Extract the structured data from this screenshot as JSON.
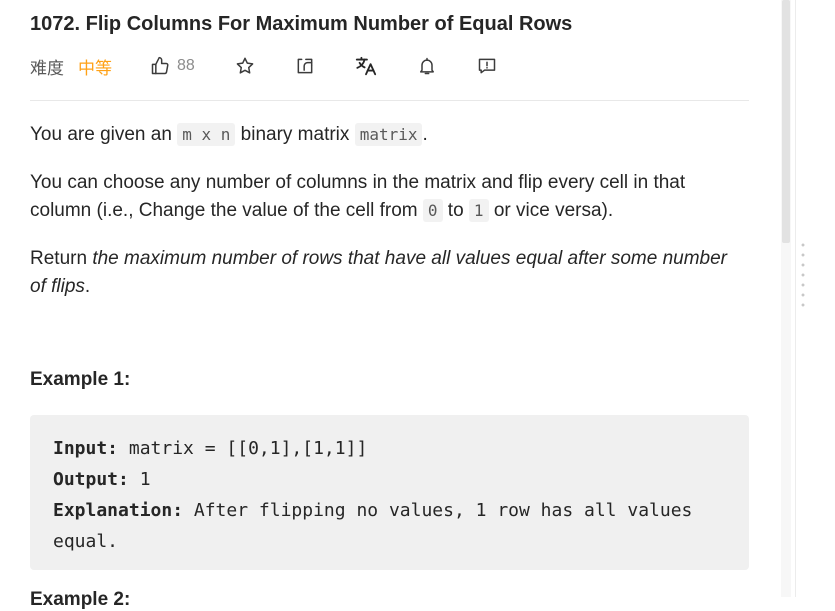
{
  "problem": {
    "title": "1072. Flip Columns For Maximum Number of Equal Rows",
    "difficulty_label": "难度",
    "difficulty_value": "中等",
    "likes": "88"
  },
  "description": {
    "p1_before": "You are given an ",
    "p1_code1": "m x n",
    "p1_middle": " binary matrix ",
    "p1_code2": "matrix",
    "p1_end": ".",
    "p2_before": "You can choose any number of columns in the matrix and flip every cell in that column (i.e., Change the value of the cell from ",
    "p2_code1": "0",
    "p2_middle": " to ",
    "p2_code2": "1",
    "p2_end": " or vice versa).",
    "p3_before": "Return ",
    "p3_italic": "the maximum number of rows that have all values equal after some number of flips",
    "p3_end": "."
  },
  "example1": {
    "title": "Example 1:",
    "input_label": "Input:",
    "input_value": " matrix = [[0,1],[1,1]]",
    "output_label": "Output:",
    "output_value": " 1",
    "explanation_label": "Explanation:",
    "explanation_value": " After flipping no values, 1 row has all values",
    "explanation_cont": "equal."
  },
  "example2": {
    "title": "Example 2:"
  },
  "icons": [
    "thumbs-up-icon",
    "star-icon",
    "share-icon",
    "translate-icon",
    "bell-icon",
    "feedback-icon"
  ],
  "colors": {
    "difficulty_medium": "#ffa116",
    "text": "#262626",
    "code_bg": "#f0f0f0"
  }
}
